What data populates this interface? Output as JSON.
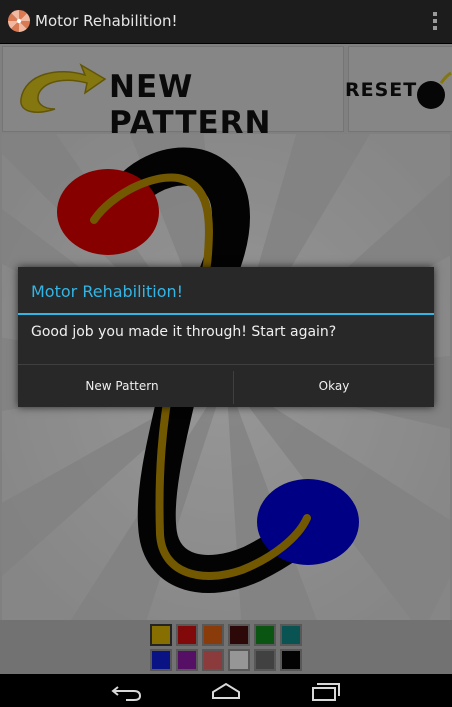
{
  "app": {
    "title": "Motor Rehabilition!",
    "icon": "pinwheel-icon"
  },
  "toolbar": {
    "new_pattern_label": "NEW PATTERN",
    "reset_label": "RESET",
    "new_pattern_icon": "swoosh-arrow-icon",
    "reset_icon": "bomb-icon"
  },
  "colors": {
    "dialog_accent": "#33b5e5",
    "track": "#000000",
    "user_path": "#c8a000",
    "start_circle": "#e00000",
    "end_circle": "#0000e0"
  },
  "palette": {
    "swatches": [
      "#d9b400",
      "#d21010",
      "#dd5f10",
      "#4a0d0d",
      "#11891c",
      "#118787",
      "#0f1fd6",
      "#8a1aa3",
      "#e06060",
      "#f2f2f2",
      "#6a6a6a",
      "#060606"
    ],
    "selected_index": 0
  },
  "dialog": {
    "title": "Motor Rehabilition!",
    "message": "Good job you made it through! Start again?",
    "negative_button": "New Pattern",
    "positive_button": "Okay"
  },
  "navbar": {
    "back_icon": "back-icon",
    "home_icon": "home-icon",
    "recents_icon": "recents-icon"
  }
}
